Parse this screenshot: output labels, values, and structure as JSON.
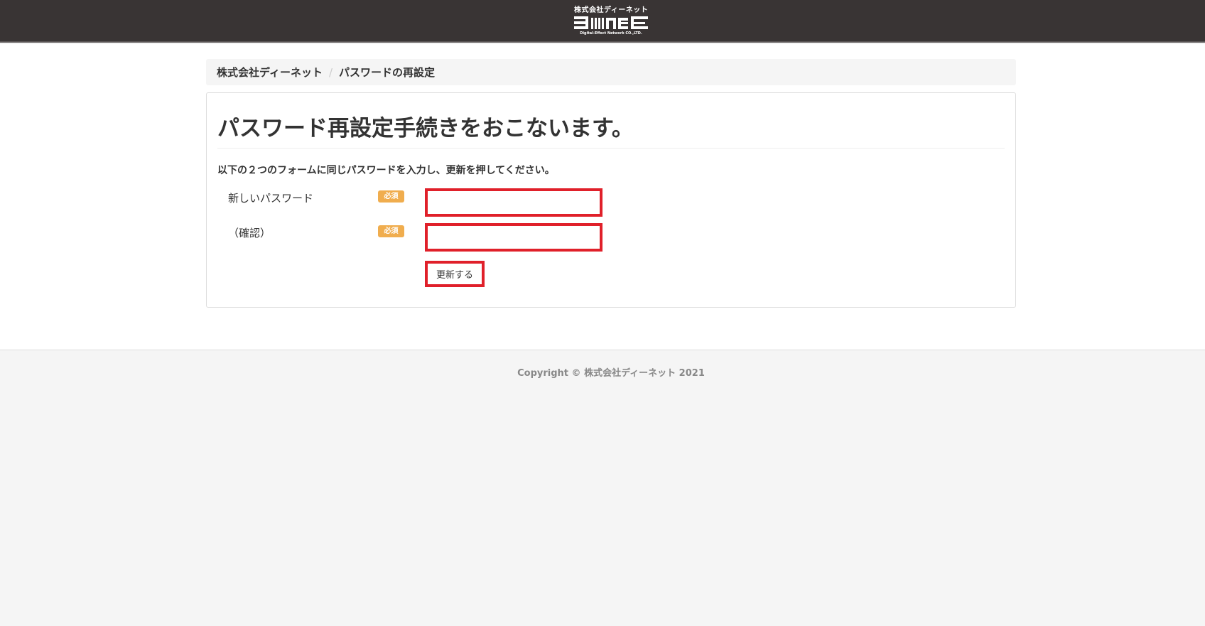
{
  "header": {
    "logo_company": "株式会社ディーネット",
    "logo_mark": "Denet",
    "logo_subtext": "Digital-Effect Network CO.,LTD."
  },
  "breadcrumb": {
    "home": "株式会社ディーネット",
    "separator": "/",
    "current": "パスワードの再設定"
  },
  "main": {
    "title": "パスワード再設定手続きをおこないます。",
    "instruction": "以下の２つのフォームに同じパスワードを入力し、更新を押してください。",
    "fields": [
      {
        "label": "新しいパスワード",
        "badge": "必須",
        "value": ""
      },
      {
        "label": "（確認）",
        "badge": "必須",
        "value": ""
      }
    ],
    "submit_label": "更新する"
  },
  "footer": {
    "copyright": "Copyright © 株式会社ディーネット 2021"
  },
  "colors": {
    "header_bg": "#393434",
    "badge_bg": "#f0ad4e",
    "highlight_border": "#e0202a"
  }
}
